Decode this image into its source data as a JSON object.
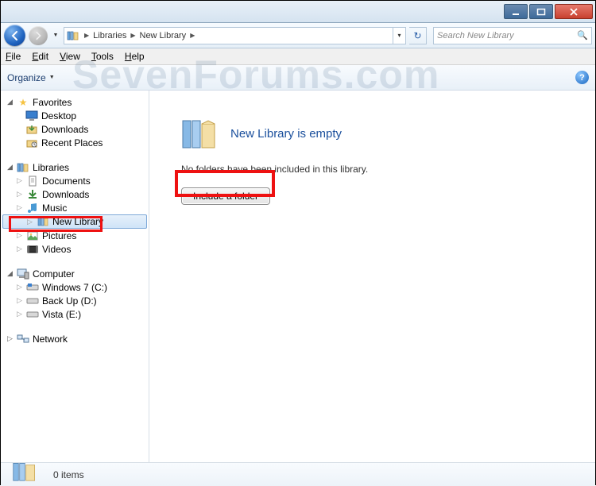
{
  "window": {
    "min": "–",
    "max": "▢",
    "close": "✕"
  },
  "nav": {
    "crumbs": [
      "Libraries",
      "New Library"
    ],
    "search_placeholder": "Search New Library"
  },
  "menu": {
    "file": "File",
    "edit": "Edit",
    "view": "View",
    "tools": "Tools",
    "help": "Help"
  },
  "toolbar": {
    "organize": "Organize"
  },
  "sidebar": {
    "favorites": {
      "label": "Favorites",
      "items": [
        "Desktop",
        "Downloads",
        "Recent Places"
      ]
    },
    "libraries": {
      "label": "Libraries",
      "items": [
        "Documents",
        "Downloads",
        "Music",
        "New Library",
        "Pictures",
        "Videos"
      ],
      "selected": "New Library"
    },
    "computer": {
      "label": "Computer",
      "items": [
        "Windows 7 (C:)",
        "Back Up (D:)",
        "Vista (E:)"
      ]
    },
    "network": {
      "label": "Network"
    }
  },
  "content": {
    "title": "New Library is empty",
    "message": "No folders have been included in this library.",
    "button": "Include a folder"
  },
  "status": {
    "items": "0 items"
  },
  "watermark": "SevenForums.com",
  "colors": {
    "highlight": "#e11",
    "link": "#1a4f9c"
  }
}
